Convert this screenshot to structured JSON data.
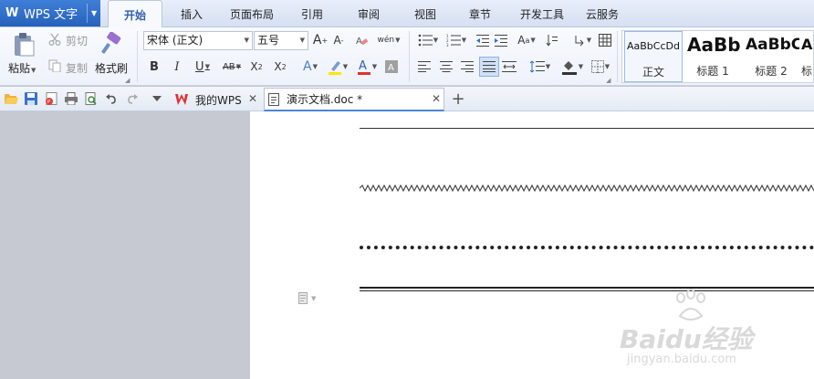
{
  "app": {
    "name": "WPS 文字",
    "brand_color": "#2f6fd0"
  },
  "menu": {
    "tabs": [
      "开始",
      "插入",
      "页面布局",
      "引用",
      "审阅",
      "视图",
      "章节",
      "开发工具",
      "云服务"
    ],
    "active_tab": "开始"
  },
  "ribbon": {
    "clipboard": {
      "paste": "粘贴",
      "cut": "剪切",
      "copy": "复制",
      "format_painter": "格式刷"
    },
    "font": {
      "name": "宋体 (正文)",
      "size": "五号",
      "font_color": "#e03030",
      "highlight_color": "#ffe600"
    },
    "styles": [
      {
        "preview": "AaBbCcDd",
        "name": "正文"
      },
      {
        "preview": "AaBb",
        "name": "标题 1"
      },
      {
        "preview": "AaBbC",
        "name": "标题 2"
      },
      {
        "preview": "A",
        "name": "标"
      }
    ]
  },
  "quick_access": {
    "icons": [
      "open-icon",
      "save-icon",
      "export-pdf-icon",
      "print-icon",
      "print-preview-icon",
      "undo-icon",
      "redo-icon",
      "customize-icon"
    ]
  },
  "doc_tabs": [
    {
      "label": "我的WPS"
    },
    {
      "label": "演示文档.doc *"
    }
  ],
  "document": {
    "lines": [
      "single",
      "wavy",
      "dotted",
      "double"
    ]
  },
  "watermark": {
    "brand": "Baidu经验",
    "url": "jingyan.baidu.com"
  }
}
